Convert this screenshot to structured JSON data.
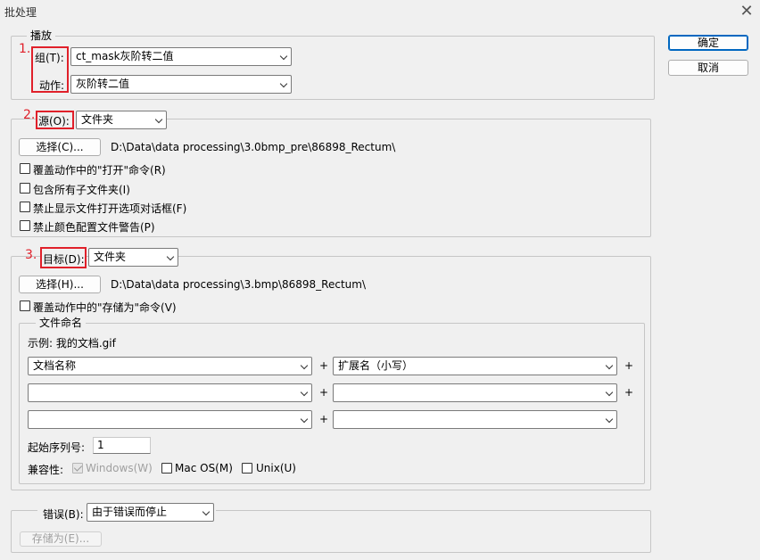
{
  "window": {
    "title": "批处理",
    "close_glyph": "✕"
  },
  "buttons": {
    "ok": "确定",
    "cancel": "取消"
  },
  "annotations": {
    "n1": "1.",
    "n2": "2.",
    "n3": "3.",
    "color": "#e0202a"
  },
  "play": {
    "legend": "播放",
    "group_label": "组(T):",
    "group_value": "ct_mask灰阶转二值",
    "action_label": "动作:",
    "action_value": "灰阶转二值"
  },
  "source": {
    "label": "源(O):",
    "value": "文件夹",
    "choose_button": "选择(C)...",
    "path": "D:\\Data\\data processing\\3.0bmp_pre\\86898_Rectum\\",
    "options": [
      "覆盖动作中的\"打开\"命令(R)",
      "包含所有子文件夹(I)",
      "禁止显示文件打开选项对话框(F)",
      "禁止颜色配置文件警告(P)"
    ]
  },
  "destination": {
    "label": "目标(D):",
    "value": "文件夹",
    "choose_button": "选择(H)...",
    "path": "D:\\Data\\data processing\\3.bmp\\86898_Rectum\\",
    "override_save": "覆盖动作中的\"存储为\"命令(V)",
    "naming": {
      "legend": "文件命名",
      "example": "示例: 我的文档.gif",
      "plus": "+",
      "rows": [
        [
          "文档名称",
          "扩展名（小写）"
        ],
        [
          "",
          ""
        ],
        [
          "",
          ""
        ]
      ],
      "serial_label": "起始序列号:",
      "serial_value": "1",
      "compat_label": "兼容性:",
      "compat_windows": "Windows(W)",
      "compat_mac": "Mac OS(M)",
      "compat_unix": "Unix(U)"
    }
  },
  "errors": {
    "label": "错误(B):",
    "value": "由于错误而停止",
    "save_as_button": "存储为(E)..."
  }
}
